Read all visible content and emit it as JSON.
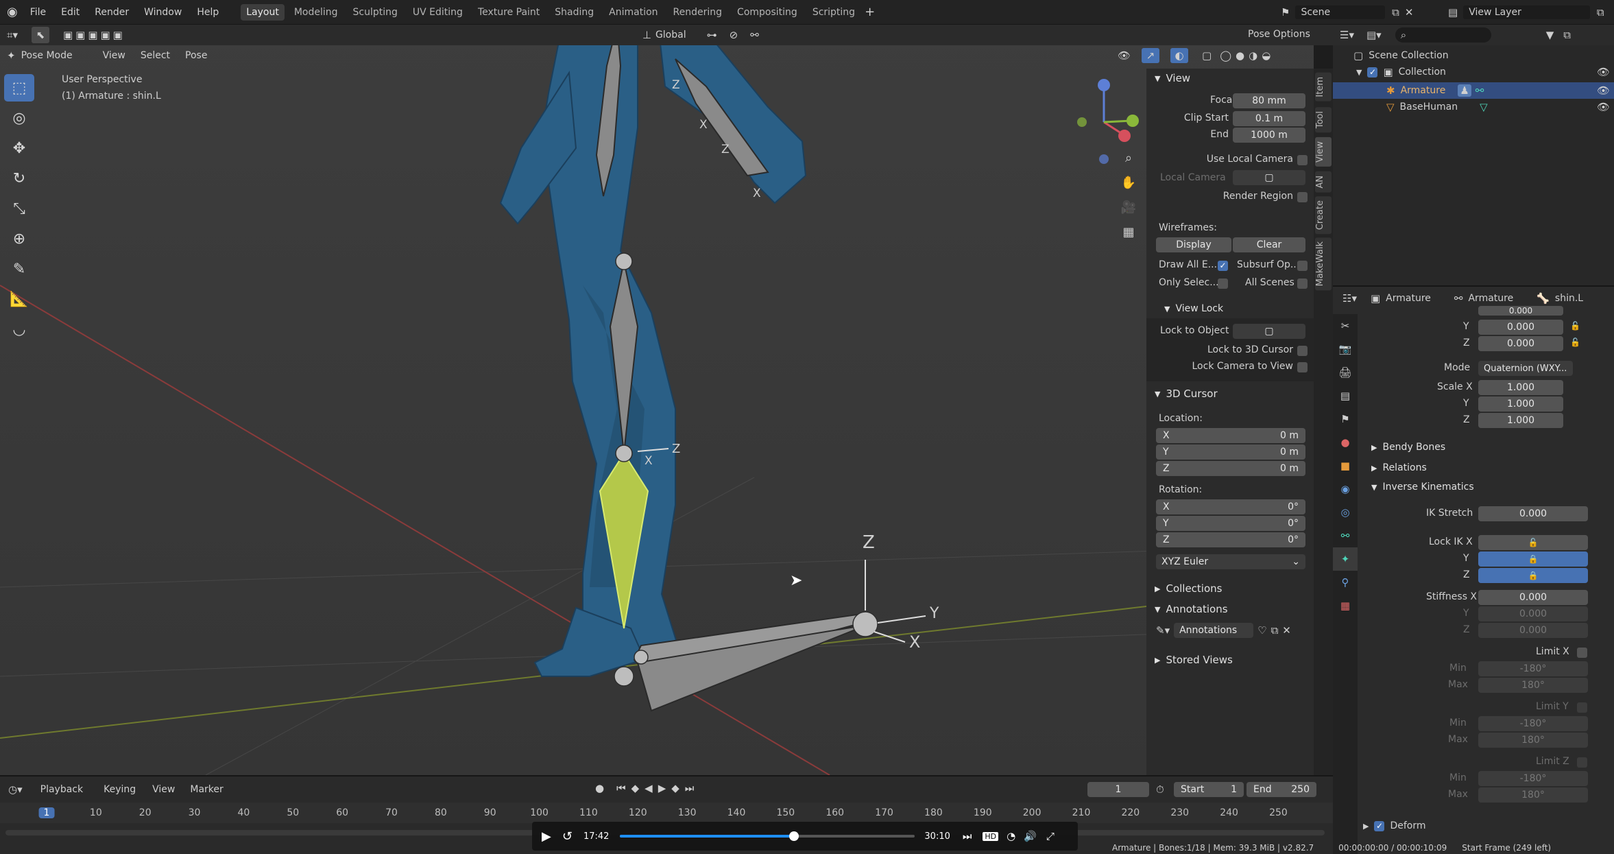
{
  "topbar": {
    "menus": [
      "File",
      "Edit",
      "Render",
      "Window",
      "Help"
    ],
    "workspaces": [
      "Layout",
      "Modeling",
      "Sculpting",
      "UV Editing",
      "Texture Paint",
      "Shading",
      "Animation",
      "Rendering",
      "Compositing",
      "Scripting"
    ],
    "active_workspace": "Layout",
    "scene": "Scene",
    "view_layer": "View Layer"
  },
  "viewport": {
    "mode": "Pose Mode",
    "menus": [
      "View",
      "Select",
      "Pose"
    ],
    "orientation": "Global",
    "pose_options": "Pose Options",
    "perspective": "User Perspective",
    "object_info": "(1) Armature : shin.L",
    "axis_labels": {
      "z1": "Z",
      "z2": "Z",
      "x1": "X",
      "x2": "X",
      "z_knee": "Z",
      "x_knee": "X",
      "z_foot": "Z",
      "y_foot": "Y",
      "x_foot": "X"
    }
  },
  "npanel": {
    "view_header": "View",
    "focal_length_label": "Focal Length",
    "focal_length": "80 mm",
    "clip_start_label": "Clip Start",
    "clip_start": "0.1 m",
    "end_label": "End",
    "end": "1000 m",
    "use_local_camera": "Use Local Camera",
    "local_camera": "Local Camera",
    "render_region": "Render Region",
    "wireframes": "Wireframes:",
    "display": "Display",
    "clear": "Clear",
    "draw_all": "Draw All E...",
    "subsurf": "Subsurf Op...",
    "only_selected": "Only Selec...",
    "all_scenes": "All Scenes",
    "view_lock": "View Lock",
    "lock_to_object": "Lock to Object",
    "lock_3d_cursor": "Lock to 3D Cursor",
    "lock_camera": "Lock Camera to View",
    "cursor_header": "3D Cursor",
    "location_label": "Location:",
    "loc": [
      {
        "axis": "X",
        "val": "0 m"
      },
      {
        "axis": "Y",
        "val": "0 m"
      },
      {
        "axis": "Z",
        "val": "0 m"
      }
    ],
    "rotation_label": "Rotation:",
    "rot": [
      {
        "axis": "X",
        "val": "0°"
      },
      {
        "axis": "Y",
        "val": "0°"
      },
      {
        "axis": "Z",
        "val": "0°"
      }
    ],
    "rot_mode": "XYZ Euler",
    "collections": "Collections",
    "annotations_header": "Annotations",
    "annotations_field": "Annotations",
    "stored_views": "Stored Views"
  },
  "sidetabs": [
    "Item",
    "Tool",
    "View",
    "AN",
    "Create",
    "MakeWalk"
  ],
  "outliner": {
    "scene_collection": "Scene Collection",
    "collection": "Collection",
    "armature": "Armature",
    "basehuman": "BaseHuman"
  },
  "props": {
    "crumb1": "Armature",
    "crumb2": "Armature",
    "crumb3": "shin.L",
    "x_top": "0.000",
    "rows_xyz": [
      {
        "label": "Y",
        "val": "0.000"
      },
      {
        "label": "Z",
        "val": "0.000"
      }
    ],
    "mode_label": "Mode",
    "mode_val": "Quaternion (WXY...",
    "scale": [
      {
        "label": "Scale X",
        "val": "1.000"
      },
      {
        "label": "Y",
        "val": "1.000"
      },
      {
        "label": "Z",
        "val": "1.000"
      }
    ],
    "bendy": "Bendy Bones",
    "relations": "Relations",
    "ik": "Inverse Kinematics",
    "ik_stretch_label": "IK Stretch",
    "ik_stretch": "0.000",
    "lock_ik_x": "Lock IK X",
    "lock_y": "Y",
    "lock_z": "Z",
    "stiff_x_label": "Stiffness X",
    "stiff_x": "0.000",
    "stiff_y_label": "Y",
    "stiff_y": "0.000",
    "stiff_z_label": "Z",
    "stiff_z": "0.000",
    "limit_x": "Limit X",
    "limit_y": "Limit Y",
    "limit_z": "Limit Z",
    "min": "Min",
    "max": "Max",
    "min_val": "-180°",
    "max_val": "180°",
    "deform": "Deform"
  },
  "timeline": {
    "menus": [
      "Playback",
      "Keying",
      "View",
      "Marker"
    ],
    "current_frame": "1",
    "start_label": "Start",
    "start": "1",
    "end_label": "End",
    "end": "250",
    "ticks": [
      "1",
      "10",
      "20",
      "30",
      "40",
      "50",
      "60",
      "70",
      "80",
      "90",
      "100",
      "110",
      "120",
      "130",
      "140",
      "150",
      "160",
      "170",
      "180",
      "190",
      "200",
      "210",
      "220",
      "230",
      "240",
      "250"
    ]
  },
  "video": {
    "current": "17:42",
    "total": "30:10",
    "progress": 0.59,
    "hd": "HD"
  },
  "statusbar": {
    "stats": "Armature | Bones:1/18 | Mem: 39.3 MiB | v2.82.7",
    "timecode": "00:00:00:00 / 00:00:10:09",
    "start_frame": "Start Frame (249 left)"
  },
  "colors": {
    "accent": "#4772b3",
    "bone_selected": "#b4c84a",
    "mesh": "#2a5f86"
  }
}
